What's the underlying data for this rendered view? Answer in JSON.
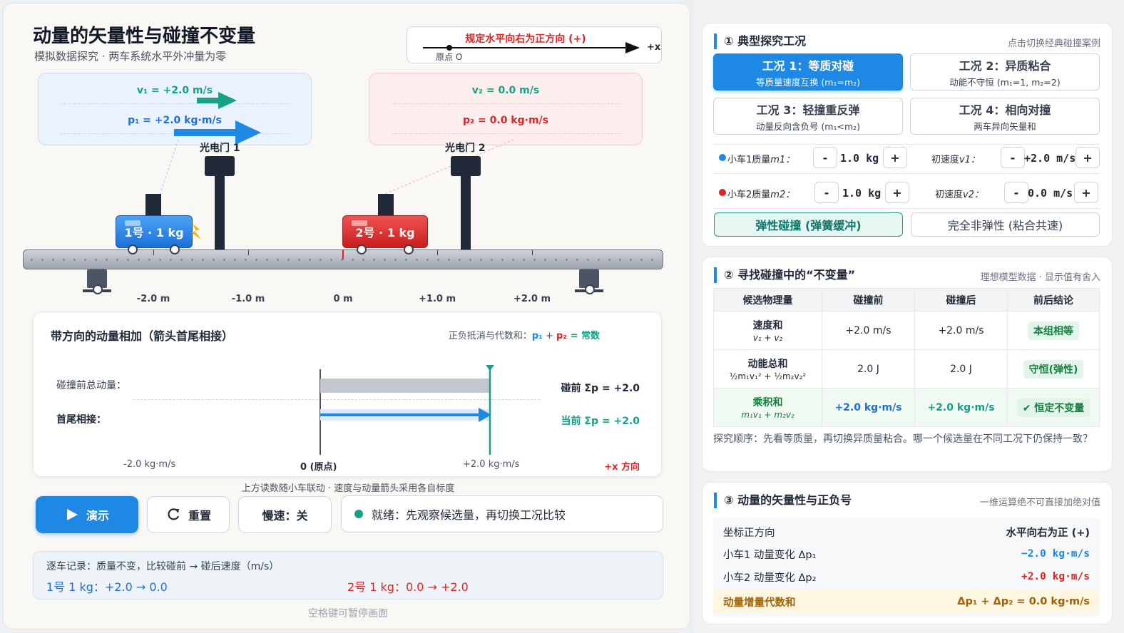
{
  "header": {
    "title": "动量的矢量性与碰撞不变量",
    "subtitle": "模拟数据探究 · 两车系统水平外冲量为零",
    "direction_label": "规定水平向右为正方向 (+)",
    "origin_label": "原点 O",
    "axis_label": "+x"
  },
  "velocity_panel": {
    "v1": "v₁ = +2.0 m/s",
    "p1": "p₁ = +2.0 kg·m/s",
    "v2": "v₂ = 0.0 m/s",
    "p2": "p₂ = 0.0 kg·m/s"
  },
  "gates": {
    "g1": "光电门 1",
    "g2": "光电门 2"
  },
  "carts": {
    "c1": "1号 · 1 kg",
    "c2": "2号 · 1 kg"
  },
  "track_ticks": [
    "-2.0 m",
    "-1.0 m",
    "0 m",
    "+1.0 m",
    "+2.0 m"
  ],
  "sum_card": {
    "title": "带方向的动量相加（箭头首尾相接）",
    "hint_prefix": "正负抵消与代数和：",
    "hint_p1": "p₁",
    "hint_plus": " + ",
    "hint_p2": "p₂",
    "hint_eq": " = 常数",
    "row_before": "碰撞前总动量：",
    "row_chain": "首尾相接：",
    "before_val": "碰前 Σp = +2.0",
    "current_val": "当前 Σp = +2.0",
    "axis_left": "-2.0 kg·m/s",
    "axis_zero": "0 (原点)",
    "axis_right": "+2.0 kg·m/s",
    "axis_dir": "+x 方向",
    "total_before": 2.0,
    "total_current": 2.0,
    "axis_range": [
      -2.0,
      2.0
    ]
  },
  "link_note": "上方读数随小车联动 · 速度与动量箭头采用各自标度",
  "controls": {
    "play": "演示",
    "reset": "重置",
    "slow": "慢速：关",
    "status": "就绪：先观察候选量，再切换工况比较"
  },
  "log": {
    "title": "逐车记录：质量不变，比较碰前 → 碰后速度（m/s）",
    "c1": "1号 1 kg：+2.0 → 0.0",
    "c2": "2号 1 kg：0.0 → +2.0"
  },
  "footer": "空格键可暂停画面",
  "section1": {
    "title": "① 典型探究工况",
    "hint": "点击切换经典碰撞案例",
    "cases": [
      {
        "title": "工况 1：等质对碰",
        "desc": "等质量速度互换 (m₁=m₂)"
      },
      {
        "title": "工况 2：异质粘合",
        "desc": "动能不守恒 (m₁=1, m₂=2)"
      },
      {
        "title": "工况 3：轻撞重反弹",
        "desc": "动量反向含负号 (m₁<m₂)"
      },
      {
        "title": "工况 4：相向对撞",
        "desc": "两车异向矢量和"
      }
    ],
    "m1_label": "小车1质量",
    "m1_sym": "m1：",
    "m1_val": "1.0 kg",
    "v1_label": "初速度",
    "v1_sym": "v1：",
    "v1_val": "+2.0 m/s",
    "m2_label": "小车2质量",
    "m2_sym": "m2：",
    "m2_val": "1.0 kg",
    "v2_label": "初速度",
    "v2_sym": "v2：",
    "v2_val": "0.0 m/s",
    "minus": "-",
    "plus": "+",
    "mode_elastic": "弹性碰撞 (弹簧缓冲)",
    "mode_inelastic": "完全非弹性 (粘合共速)"
  },
  "section2": {
    "title": "② 寻找碰撞中的“不变量”",
    "hint": "理想模型数据 · 显示值有舍入",
    "headers": [
      "候选物理量",
      "碰撞前",
      "碰撞后",
      "前后结论"
    ],
    "rows": [
      {
        "name": "速度和",
        "formula": "v₁ + v₂",
        "before": "+2.0 m/s",
        "after": "+2.0 m/s",
        "verdict": "本组相等"
      },
      {
        "name": "动能总和",
        "formula": "½m₁v₁² + ½m₂v₂²",
        "before": "2.0 J",
        "after": "2.0 J",
        "verdict": "守恒(弹性)"
      },
      {
        "name": "乘积和",
        "formula": "m₁v₁ + m₂v₂",
        "before": "+2.0 kg·m/s",
        "after": "+2.0 kg·m/s",
        "verdict": "✔ 恒定不变量"
      }
    ],
    "note": "探究顺序：先看等质量，再切换异质量粘合。哪一个候选量在不同工况下仍保持一致？"
  },
  "section3": {
    "title": "③ 动量的矢量性与正负号",
    "hint": "一维运算绝不可直接加绝对值",
    "rows": [
      {
        "label": "坐标正方向",
        "value": "水平向右为正 (+)"
      },
      {
        "label": "小车1 动量变化 Δp₁",
        "value": "−2.0 kg·m/s"
      },
      {
        "label": "小车2 动量变化 Δp₂",
        "value": "+2.0 kg·m/s"
      },
      {
        "label": "动量增量代数和",
        "value": "Δp₁ + Δp₂ = 0.0 kg·m/s"
      }
    ]
  },
  "colors": {
    "accent": "#1e88e5",
    "cart1": "#1e6fd9",
    "cart2": "#c81e1e",
    "green": "#16a085",
    "red": "#dc2626"
  }
}
